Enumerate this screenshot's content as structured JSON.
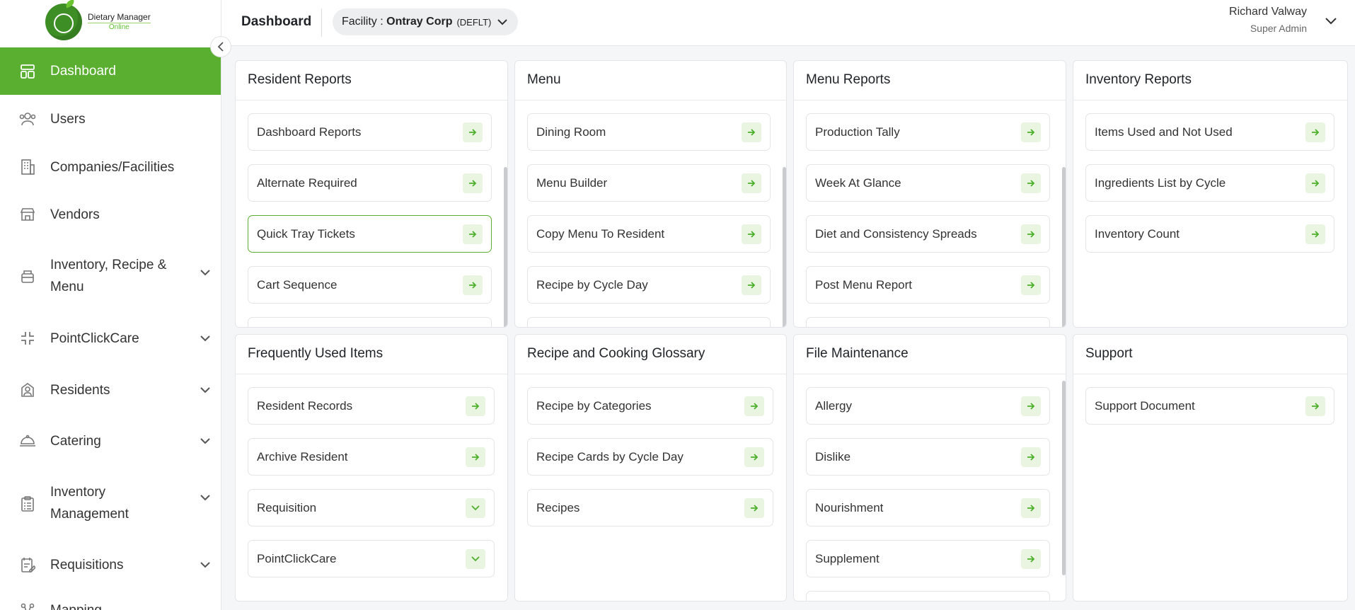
{
  "brand": {
    "line1": "Dietary Manager",
    "line2": "Online"
  },
  "sidebar": {
    "items": [
      {
        "label": "Dashboard",
        "icon": "dashboard-icon",
        "active": true
      },
      {
        "label": "Users",
        "icon": "users-icon"
      },
      {
        "label": "Companies/Facilities",
        "icon": "building-icon"
      },
      {
        "label": "Vendors",
        "icon": "store-icon"
      },
      {
        "label": "Inventory, Recipe & Menu",
        "icon": "box-icon",
        "expandable": true
      },
      {
        "label": "PointClickCare",
        "icon": "collapse-arrows-icon",
        "expandable": true
      },
      {
        "label": "Residents",
        "icon": "resident-icon",
        "expandable": true
      },
      {
        "label": "Catering",
        "icon": "catering-icon",
        "expandable": true
      },
      {
        "label": "Inventory Management",
        "icon": "clipboard-icon",
        "expandable": true
      },
      {
        "label": "Requisitions",
        "icon": "requisition-icon",
        "expandable": true
      },
      {
        "label": "Mapping",
        "icon": "mapping-icon"
      }
    ]
  },
  "header": {
    "title": "Dashboard",
    "facility_prefix": "Facility : ",
    "facility_name": "Ontray Corp",
    "facility_code": "(DEFLT)",
    "user_name": "Richard Valway",
    "user_role": "Super Admin"
  },
  "cards": [
    {
      "title": "Resident Reports",
      "items": [
        "Dashboard Reports",
        "Alternate Required",
        "Quick Tray Tickets",
        "Cart Sequence"
      ]
    },
    {
      "title": "Menu",
      "items": [
        "Dining Room",
        "Menu Builder",
        "Copy Menu To Resident",
        "Recipe by Cycle Day"
      ]
    },
    {
      "title": "Menu Reports",
      "items": [
        "Production Tally",
        "Week At Glance",
        "Diet and Consistency Spreads",
        "Post Menu Report"
      ]
    },
    {
      "title": "Inventory Reports",
      "items": [
        "Items Used and Not Used",
        "Ingredients List by Cycle",
        "Inventory Count"
      ]
    },
    {
      "title": "Frequently Used Items",
      "items": [
        "Resident Records",
        "Archive Resident",
        "Requisition",
        "PointClickCare"
      ]
    },
    {
      "title": "Recipe and Cooking Glossary",
      "items": [
        "Recipe by Categories",
        "Recipe Cards by Cycle Day",
        "Recipes"
      ]
    },
    {
      "title": "File Maintenance",
      "items": [
        "Allergy",
        "Dislike",
        "Nourishment",
        "Supplement"
      ]
    },
    {
      "title": "Support",
      "items": [
        "Support Document"
      ]
    }
  ],
  "colors": {
    "accent": "#5aaf30",
    "accent_light": "#e9f5e1"
  }
}
